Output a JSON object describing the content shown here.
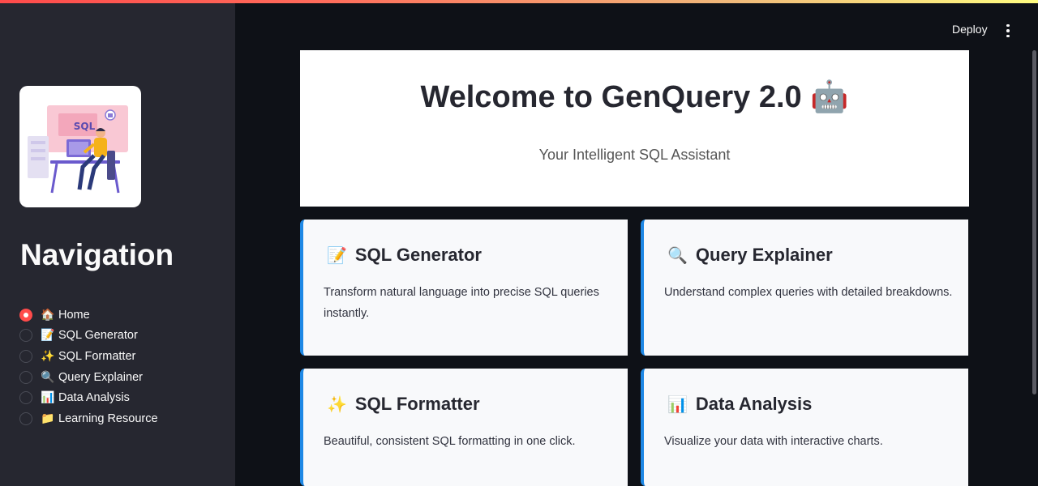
{
  "header": {
    "deploy_label": "Deploy"
  },
  "sidebar": {
    "title": "Navigation",
    "logo_text": "SQL",
    "items": [
      {
        "emoji": "🏠",
        "label": "Home",
        "selected": true
      },
      {
        "emoji": "📝",
        "label": "SQL Generator",
        "selected": false
      },
      {
        "emoji": "✨",
        "label": "SQL Formatter",
        "selected": false
      },
      {
        "emoji": "🔍",
        "label": "Query Explainer",
        "selected": false
      },
      {
        "emoji": "📊",
        "label": "Data Analysis",
        "selected": false
      },
      {
        "emoji": "📁",
        "label": "Learning Resource",
        "selected": false
      }
    ]
  },
  "hero": {
    "title": "Welcome to GenQuery 2.0",
    "title_emoji": "🤖",
    "subtitle": "Your Intelligent SQL Assistant"
  },
  "cards": [
    {
      "emoji": "📝",
      "title": "SQL Generator",
      "desc": "Transform natural language into precise SQL queries instantly."
    },
    {
      "emoji": "🔍",
      "title": "Query Explainer",
      "desc": "Understand complex queries with detailed breakdowns."
    },
    {
      "emoji": "✨",
      "title": "SQL Formatter",
      "desc": "Beautiful, consistent SQL formatting in one click."
    },
    {
      "emoji": "📊",
      "title": "Data Analysis",
      "desc": "Visualize your data with interactive charts."
    }
  ],
  "colors": {
    "accent": "#ff4b4b",
    "card_border": "#1e88e5",
    "sidebar_bg": "#262730",
    "app_bg": "#0e1117"
  }
}
